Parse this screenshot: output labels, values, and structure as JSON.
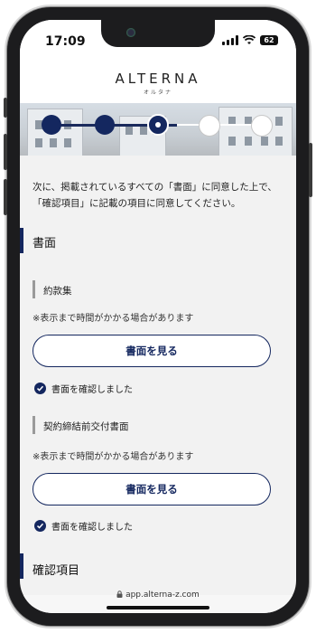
{
  "status": {
    "time": "17:09",
    "battery": "62"
  },
  "header": {
    "brand": "ALTERNA",
    "brand_sub": "オルタナ"
  },
  "steps": {
    "total": 5,
    "completed": 2,
    "current": 3
  },
  "intro": "次に、掲載されているすべての「書面」に同意した上で、「確認項目」に記載の項目に同意してください。",
  "documents": {
    "title": "書面",
    "items": [
      {
        "name": "約款集",
        "note": "※表示まで時間がかかる場合があります",
        "button": "書面を見る",
        "confirmed": "書面を確認しました"
      },
      {
        "name": "契約締結前交付書面",
        "note": "※表示まで時間がかかる場合があります",
        "button": "書面を見る",
        "confirmed": "書面を確認しました"
      }
    ]
  },
  "confirm": {
    "title": "確認項目"
  },
  "browser": {
    "url": "app.alterna-z.com"
  },
  "colors": {
    "accent": "#14275f"
  }
}
